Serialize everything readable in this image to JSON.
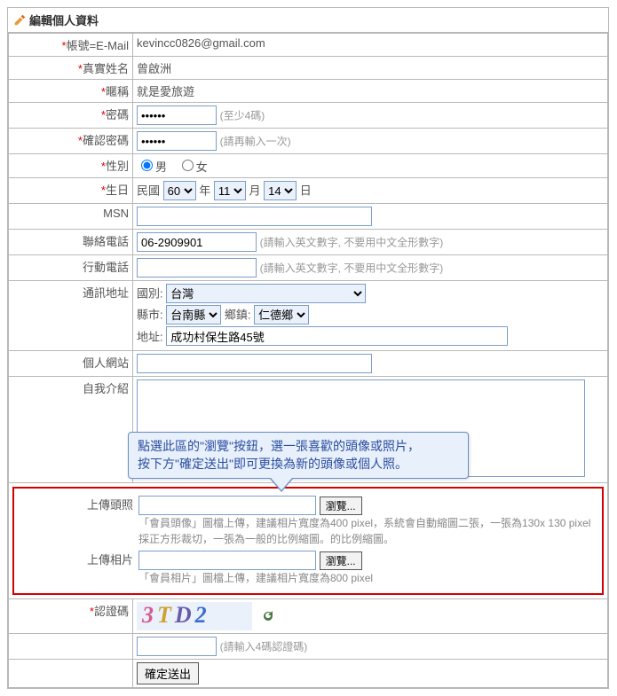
{
  "panel_title": "編輯個人資料",
  "labels": {
    "account": "帳號=E-Mail",
    "realname": "真實姓名",
    "nickname": "暱稱",
    "password": "密碼",
    "confirm": "確認密碼",
    "gender": "性別",
    "birthday": "生日",
    "msn": "MSN",
    "phone": "聯絡電話",
    "mobile": "行動電話",
    "address": "通訊地址",
    "website": "個人網站",
    "intro": "自我介紹",
    "avatar": "上傳頭照",
    "photo": "上傳相片",
    "captcha": "認證碼"
  },
  "values": {
    "account": "kevincc0826@gmail.com",
    "realname": "曾啟洲",
    "nickname": "就是愛旅遊",
    "password": "••••••",
    "confirm": "••••••",
    "phone": "06-2909901",
    "mobile": "",
    "msn": "",
    "website": "",
    "intro": "",
    "addr_detail": "成功村保生路45號",
    "captcha_input": ""
  },
  "hints": {
    "password": "(至少4碼)",
    "confirm": "(請再輸入一次)",
    "phone": "(請輸入英文數字, 不要用中文全形數字)",
    "mobile": "(請輸入英文數字, 不要用中文全形數字)",
    "captcha": "(請輸入4碼認證碼)"
  },
  "gender": {
    "male": "男",
    "female": "女",
    "selected": "male"
  },
  "birthday": {
    "era": "民國",
    "year": "60",
    "year_unit": "年",
    "month": "11",
    "month_unit": "月",
    "day": "14",
    "day_unit": "日"
  },
  "address": {
    "country_label": "國別:",
    "country": "台灣",
    "county_label": "縣市:",
    "county": "台南縣",
    "town_label": "鄉鎮:",
    "town": "仁德鄉",
    "detail_label": "地址:"
  },
  "upload": {
    "browse": "瀏覽...",
    "avatar_desc": "「會員頭像」圖檔上傳，建議相片寬度為400 pixel，系統會自動縮圖二張，一張為130x 130 pixel採正方形裁切，一張為一般的比例縮圖。的比例縮圖。",
    "photo_desc": "「會員相片」圖檔上傳，建議相片寬度為800 pixel"
  },
  "callout": {
    "line1": "點選此區的\"瀏覽\"按鈕，選一張喜歡的頭像或照片，",
    "line2": "按下方\"確定送出\"即可更換為新的頭像或個人照。"
  },
  "captcha_value": "3TD2",
  "submit": "確定送出"
}
